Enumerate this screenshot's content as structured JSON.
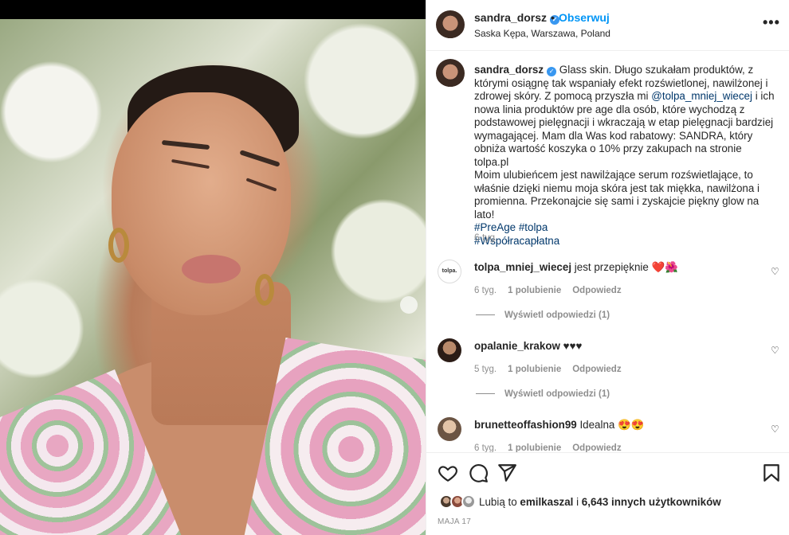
{
  "header": {
    "username": "sandra_dorsz",
    "separator": "•",
    "follow_label": "Obserwuj",
    "location": "Saska Kępa, Warszawa, Poland",
    "more_label": "•••"
  },
  "caption": {
    "username": "sandra_dorsz",
    "text_part1": " Glass skin. Długo szukałam produktów, z którymi osiągnę tak wspaniały efekt rozświetlonej, nawilżonej i zdrowej skóry. Z pomocą przyszła mi ",
    "mention": "@tolpa_mniej_wiecej",
    "text_part2": " i ich nowa linia produktów pre age dla osób, które wychodzą z podstawowej pielęgnacji i wkraczają w etap pielęgnacji bardziej wymagającej. Mam dla Was kod rabatowy: SANDRA, który obniża wartość koszyka o 10% przy zakupach na stronie tolpa.pl",
    "text_part3": "Moim ulubieńcem jest nawilżające serum rozświetlające, to właśnie dzięki niemu moja skóra jest tak miękka, nawilżona i promienna. Przekonajcie się sami i zyskajcie piękny glow na lato!",
    "hashtags_line1": "#PreAge #tolpa",
    "hashtags_line2": "#Współracapłatna",
    "age": "6 tyg."
  },
  "comments": [
    {
      "username": "tolpa_mniej_wiecej",
      "avatar_text": "tolpa.",
      "text": " jest przepięknie ",
      "emoji": "❤️🌺",
      "time": "6 tyg.",
      "likes": "1 polubienie",
      "reply": "Odpowiedz",
      "view_replies": "Wyświetl odpowiedzi (1)"
    },
    {
      "username": "opalanie_krakow",
      "text": " ♥♥♥",
      "time": "5 tyg.",
      "likes": "1 polubienie",
      "reply": "Odpowiedz",
      "view_replies": "Wyświetl odpowiedzi (1)"
    },
    {
      "username": "brunetteoffashion99",
      "text": " Idealna ",
      "emoji": "😍😍",
      "time": "6 tyg.",
      "likes": "1 polubienie",
      "reply": "Odpowiedz"
    }
  ],
  "footer": {
    "likes_prefix": "Lubią to ",
    "likes_user": "emilkaszal",
    "likes_mid": " i ",
    "likes_count": "6,643 innych użytkowników",
    "date": "MAJA 17"
  },
  "colors": {
    "accent": "#0095f6",
    "text": "#262626",
    "muted": "#8e8e8e",
    "mention": "#00376b"
  }
}
